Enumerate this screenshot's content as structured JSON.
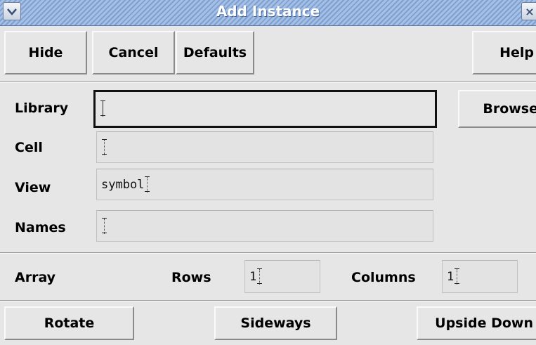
{
  "window": {
    "title": "Add Instance"
  },
  "toolbar": {
    "hide": "Hide",
    "cancel": "Cancel",
    "defaults": "Defaults",
    "help": "Help"
  },
  "form": {
    "library": {
      "label": "Library",
      "value": ""
    },
    "cell": {
      "label": "Cell",
      "value": ""
    },
    "view": {
      "label": "View",
      "value": "symbol"
    },
    "names": {
      "label": "Names",
      "value": ""
    },
    "browse": "Browse"
  },
  "array": {
    "label": "Array",
    "rows_label": "Rows",
    "rows_value": "1",
    "columns_label": "Columns",
    "columns_value": "1"
  },
  "orient": {
    "rotate": "Rotate",
    "sideways": "Sideways",
    "upside_down": "Upside Down"
  },
  "icons": {
    "menu": "chevron-down-icon",
    "close": "close-icon"
  }
}
